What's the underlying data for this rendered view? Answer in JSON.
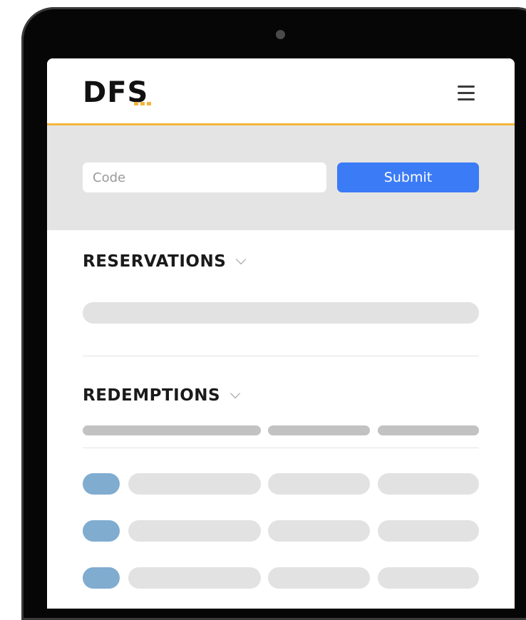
{
  "header": {
    "logo_text": "DFS",
    "menu_icon": "hamburger-menu-icon"
  },
  "code_form": {
    "placeholder": "Code",
    "value": "",
    "submit_label": "Submit"
  },
  "reservations": {
    "title": "RESERVATIONS",
    "icon": "chevron-down-icon"
  },
  "redemptions": {
    "title": "REDEMPTIONS",
    "icon": "chevron-down-icon",
    "placeholder_rows": 3
  },
  "colors": {
    "accent": "#f2b53b",
    "primary": "#3b7bf6",
    "placeholder_blue": "#80acd0",
    "skeleton": "#e2e2e2",
    "skeleton_header": "#c2c2c2",
    "code_bar_bg": "#e4e4e4"
  }
}
